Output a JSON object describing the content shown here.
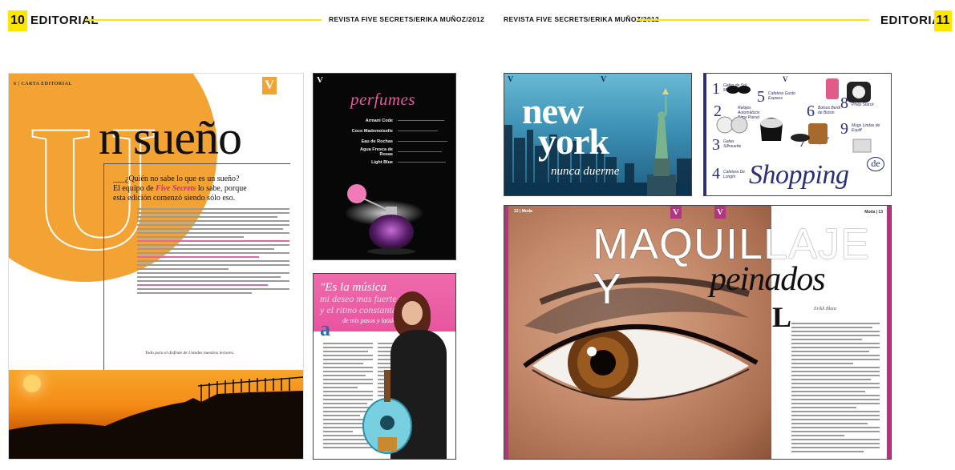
{
  "left_page": {
    "page_number": "10",
    "section": "EDITORIAL",
    "credit": "REVISTA FIVE SECRETS/ERIKA MUÑOZ/2012",
    "carta": {
      "folio": "6 | CARTA EDITORIAL",
      "badge": "V",
      "drop_letter": "U",
      "headline": "n sueño",
      "lead_line1": "___¿Quién no sabe lo que es un sueño?",
      "lead_line2_pre": "El equipo de ",
      "lead_brand": "Five Secrets",
      "lead_line2_post": " lo sabe, porque",
      "lead_line3": "esta edición comenzó siendo sólo eso.",
      "closing": "Todo para el disfrute de Ustedes nuestros lectores."
    },
    "perfumes": {
      "title": "perfumes",
      "items": [
        "Armani Code",
        "Coco Mademoiselle",
        "Eau de Rochas",
        "Agua Fresca de Rosas",
        "Light Blue"
      ]
    },
    "musica": {
      "quote_line1": "\"Es la música",
      "quote_line2": "mi deseo mas fuerte",
      "quote_line3": "y el ritmo constante",
      "quote_line4": "de mis pasos y latidos\""
    }
  },
  "right_page": {
    "page_number": "11",
    "section": "EDITORIAL",
    "credit": "REVISTA FIVE SECRETS/ERIKA MUÑOZ/2012",
    "newyork": {
      "title_line1": "new",
      "title_line2": "york",
      "subtitle": "nunca duerme"
    },
    "shopping": {
      "title": "Shopping",
      "de": "de",
      "items": [
        {
          "n": "1",
          "label": "Gafas de Sol Marco Poesy"
        },
        {
          "n": "2",
          "label": "Relojes Automáticos Bimu Parcel"
        },
        {
          "n": "3",
          "label": "Gafas Silhouette"
        },
        {
          "n": "4",
          "label": "Cafetera De Longhi"
        },
        {
          "n": "5",
          "label": "Cafetera Gusto Express"
        },
        {
          "n": "6",
          "label": "Bolsos Berdi de Bolsin"
        },
        {
          "n": "7",
          "label": "Tenis Altos Vie Kym"
        },
        {
          "n": "8",
          "label": "Diseño de Philip Starck"
        },
        {
          "n": "9",
          "label": "Mugs Lindas de Espiff"
        }
      ]
    },
    "maquillaje": {
      "folio_left": "12 | Moda",
      "folio_right": "Moda | 13",
      "title_line1": "Maquillaje y",
      "title_line2": "peinados",
      "drop_letter": "L",
      "byline": "Erikh Blanc"
    }
  },
  "colors": {
    "accent_yellow": "#ffe600",
    "carta_orange": "#f2a333",
    "brand_pink": "#d8267c",
    "perfume_pink": "#e55a9c",
    "musica_pink": "#e8559f",
    "shopping_navy": "#2a2f7c",
    "maquillaje_magenta": "#b2357f"
  },
  "icons": [
    "v-monogram-icon",
    "statue-of-liberty-icon",
    "perfume-bottle-icon",
    "guitar-icon",
    "sunglasses-icon",
    "espresso-machine-icon"
  ]
}
